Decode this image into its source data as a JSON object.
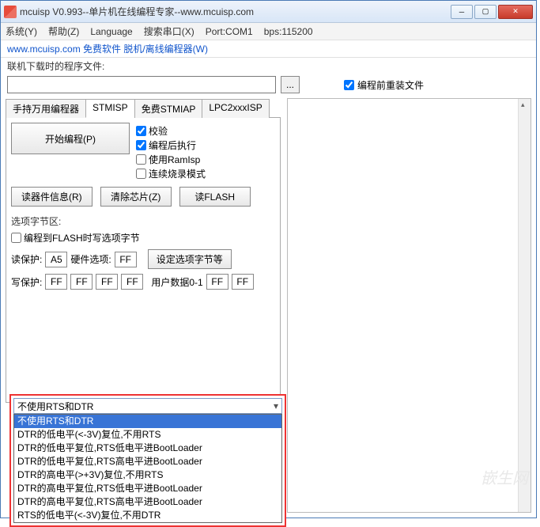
{
  "titlebar": {
    "title": "mcuisp V0.993--单片机在线编程专家--www.mcuisp.com"
  },
  "menubar": {
    "system": "系统(Y)",
    "help": "帮助(Z)",
    "language": "Language",
    "search_port": "搜索串口(X)",
    "port": "Port:COM1",
    "bps": "bps:115200"
  },
  "infobar": {
    "text": "www.mcuisp.com 免费软件 脱机/离线编程器(W)"
  },
  "toprow": {
    "label": "联机下载时的程序文件:",
    "filepath": "",
    "browse": "...",
    "reload_label": "编程前重装文件",
    "reload_checked": true
  },
  "tabs": [
    {
      "id": "hand",
      "label": "手持万用编程器",
      "active": false
    },
    {
      "id": "stmisp",
      "label": "STMISP",
      "active": true
    },
    {
      "id": "stmiap",
      "label": "免费STMIAP",
      "active": false
    },
    {
      "id": "lpc",
      "label": "LPC2xxxISP",
      "active": false
    }
  ],
  "prog": {
    "start_btn": "开始编程(P)",
    "checks": {
      "verify": {
        "label": "校验",
        "checked": true
      },
      "run_after": {
        "label": "编程后执行",
        "checked": true
      },
      "ramisp": {
        "label": "使用RamIsp",
        "checked": false
      },
      "continuous": {
        "label": "连续烧录模式",
        "checked": false
      }
    }
  },
  "btnrow": {
    "read_info": "读器件信息(R)",
    "erase": "清除芯片(Z)",
    "read_flash": "读FLASH"
  },
  "option": {
    "section": "选项字节区:",
    "write_opt": {
      "label": "编程到FLASH时写选项字节",
      "checked": false
    },
    "read_protect": "读保护:",
    "read_protect_val": "A5",
    "hw_option": "硬件选项:",
    "hw_option_val": "FF",
    "set_btn": "设定选项字节等",
    "write_protect": "写保护:",
    "wp_vals": [
      "FF",
      "FF",
      "FF",
      "FF"
    ],
    "user_data": "用户数据0-1",
    "ud_vals": [
      "FF",
      "FF"
    ]
  },
  "dropdown": {
    "selected": "不使用RTS和DTR",
    "items": [
      "不使用RTS和DTR",
      "DTR的低电平(<-3V)复位,不用RTS",
      "DTR的低电平复位,RTS低电平进BootLoader",
      "DTR的低电平复位,RTS高电平进BootLoader",
      "DTR的高电平(>+3V)复位,不用RTS",
      "DTR的高电平复位,RTS低电平进BootLoader",
      "DTR的高电平复位,RTS高电平进BootLoader",
      "RTS的低电平(<-3V)复位,不用DTR"
    ],
    "selected_index": 0
  },
  "watermark": "嵌生网"
}
